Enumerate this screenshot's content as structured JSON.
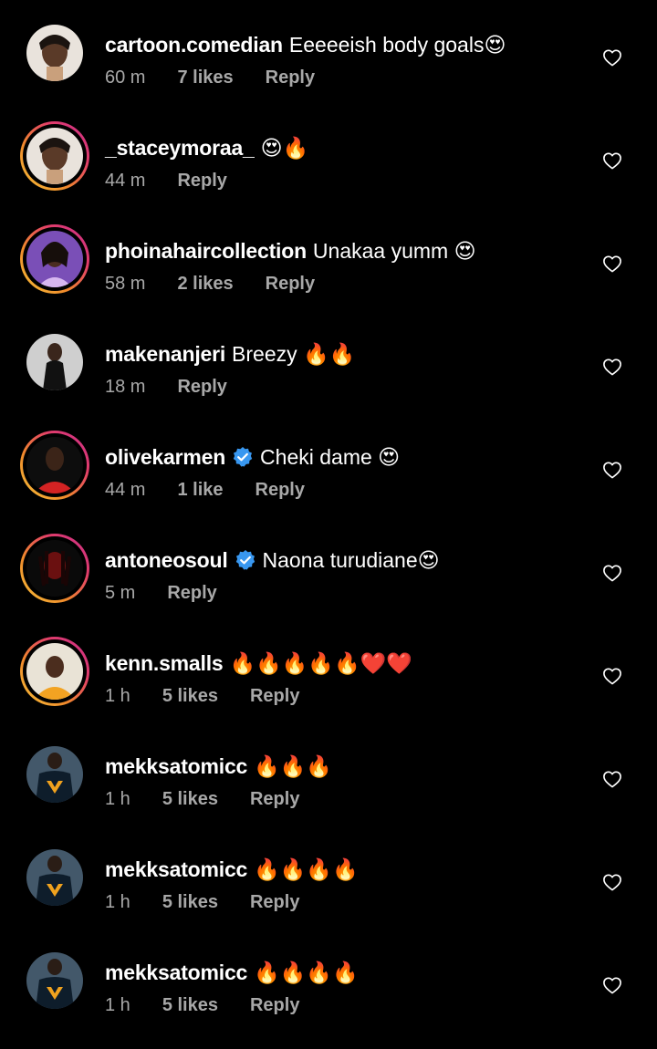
{
  "colors": {
    "background": "#000000",
    "text": "#ffffff",
    "meta": "#a8a8a8",
    "verified": "#3897f0",
    "story_ring": [
      "#f6c33a",
      "#f08a2b",
      "#e23d6b",
      "#c62d8d"
    ]
  },
  "comments": [
    {
      "username": "cartoon.comedian",
      "text": "Eeeeeish body goals😍",
      "time": "60 m",
      "likes": "7 likes",
      "reply": "Reply",
      "story_ring": false,
      "verified": false,
      "avatar_icon": "avatar-woman-icon"
    },
    {
      "username": "_staceymoraa_",
      "text": "😍🔥",
      "time": "44 m",
      "likes": "",
      "reply": "Reply",
      "story_ring": true,
      "verified": false,
      "avatar_icon": "avatar-woman-icon"
    },
    {
      "username": "phoinahaircollection",
      "text": "Unakaa yumm 😍",
      "time": "58 m",
      "likes": "2 likes",
      "reply": "Reply",
      "story_ring": true,
      "verified": false,
      "avatar_icon": "avatar-woman-purple-icon"
    },
    {
      "username": "makenanjeri",
      "text": "Breezy 🔥🔥",
      "time": "18 m",
      "likes": "",
      "reply": "Reply",
      "story_ring": false,
      "verified": false,
      "avatar_icon": "avatar-person-dark-icon"
    },
    {
      "username": "olivekarmen",
      "text": "Cheki dame 😍",
      "time": "44 m",
      "likes": "1 like",
      "reply": "Reply",
      "story_ring": true,
      "verified": true,
      "avatar_icon": "avatar-woman-red-icon"
    },
    {
      "username": "antoneosoul",
      "text": "Naona turudiane😍",
      "time": "5 m",
      "likes": "",
      "reply": "Reply",
      "story_ring": true,
      "verified": true,
      "avatar_icon": "avatar-man-red-light-icon"
    },
    {
      "username": "kenn.smalls",
      "text": "🔥🔥🔥🔥🔥❤️❤️",
      "time": "1 h",
      "likes": "5 likes",
      "reply": "Reply",
      "story_ring": true,
      "verified": false,
      "avatar_icon": "avatar-man-yellow-icon"
    },
    {
      "username": "mekksatomicc",
      "text": "🔥🔥🔥",
      "time": "1 h",
      "likes": "5 likes",
      "reply": "Reply",
      "story_ring": false,
      "verified": false,
      "avatar_icon": "avatar-man-tshirt-icon"
    },
    {
      "username": "mekksatomicc",
      "text": "🔥🔥🔥🔥",
      "time": "1 h",
      "likes": "5 likes",
      "reply": "Reply",
      "story_ring": false,
      "verified": false,
      "avatar_icon": "avatar-man-tshirt-icon"
    },
    {
      "username": "mekksatomicc",
      "text": "🔥🔥🔥🔥",
      "time": "1 h",
      "likes": "5 likes",
      "reply": "Reply",
      "story_ring": false,
      "verified": false,
      "avatar_icon": "avatar-man-tshirt-icon"
    }
  ]
}
